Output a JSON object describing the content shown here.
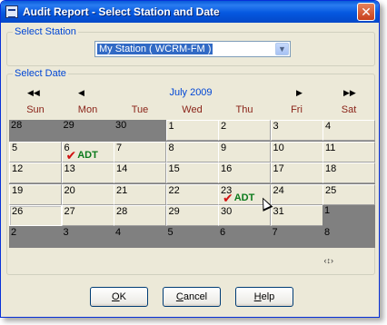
{
  "window": {
    "title": "Audit Report - Select Station and Date",
    "close_glyph": "✕"
  },
  "station": {
    "group_label": "Select Station",
    "selected": "My Station ( WCRM-FM )"
  },
  "calendar": {
    "group_label": "Select Date",
    "month_label": "July 2009",
    "nav": {
      "prev_year": "◀◀",
      "prev_month": "◀",
      "next_month": "▶",
      "next_year": "▶▶"
    },
    "days_of_week": [
      "Sun",
      "Mon",
      "Tue",
      "Wed",
      "Thu",
      "Fri",
      "Sat"
    ],
    "weeks": [
      [
        {
          "d": "28",
          "o": true
        },
        {
          "d": "29",
          "o": true
        },
        {
          "d": "30",
          "o": true
        },
        {
          "d": "1"
        },
        {
          "d": "2"
        },
        {
          "d": "3"
        },
        {
          "d": "4"
        }
      ],
      [
        {
          "d": "5"
        },
        {
          "d": "6",
          "adt": true
        },
        {
          "d": "7"
        },
        {
          "d": "8"
        },
        {
          "d": "9"
        },
        {
          "d": "10"
        },
        {
          "d": "11"
        }
      ],
      [
        {
          "d": "12"
        },
        {
          "d": "13"
        },
        {
          "d": "14"
        },
        {
          "d": "15"
        },
        {
          "d": "16"
        },
        {
          "d": "17"
        },
        {
          "d": "18"
        }
      ],
      [
        {
          "d": "19"
        },
        {
          "d": "20"
        },
        {
          "d": "21"
        },
        {
          "d": "22"
        },
        {
          "d": "23",
          "adt": true
        },
        {
          "d": "24"
        },
        {
          "d": "25"
        }
      ],
      [
        {
          "d": "26",
          "today": true
        },
        {
          "d": "27"
        },
        {
          "d": "28"
        },
        {
          "d": "29"
        },
        {
          "d": "30"
        },
        {
          "d": "31"
        },
        {
          "d": "1",
          "o": true
        }
      ],
      [
        {
          "d": "2",
          "o": true
        },
        {
          "d": "3",
          "o": true
        },
        {
          "d": "4",
          "o": true
        },
        {
          "d": "5",
          "o": true
        },
        {
          "d": "6",
          "o": true
        },
        {
          "d": "7",
          "o": true
        },
        {
          "d": "8",
          "o": true
        }
      ]
    ],
    "marker_label": "ADT",
    "marker_glyph": "✔",
    "size_grip_glyph": "‹↕›"
  },
  "buttons": {
    "ok": {
      "underline": "O",
      "rest": "K"
    },
    "cancel": {
      "underline": "C",
      "rest": "ancel"
    },
    "help": {
      "underline": "H",
      "rest": "elp"
    }
  }
}
